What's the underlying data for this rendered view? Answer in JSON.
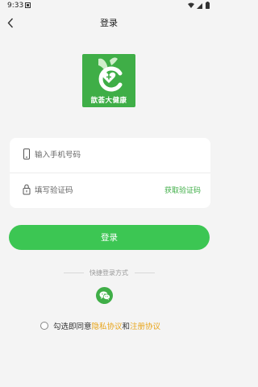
{
  "status_bar": {
    "time": "9:33"
  },
  "header": {
    "title": "登录"
  },
  "logo": {
    "text": "歆荟大健康"
  },
  "form": {
    "phone_placeholder": "输入手机号码",
    "code_placeholder": "填写验证码",
    "get_code_label": "获取验证码"
  },
  "login_button": {
    "label": "登录"
  },
  "quick_login": {
    "label": "快捷登录方式"
  },
  "agreement": {
    "prefix": "勾选即同意",
    "privacy_link": "隐私协议",
    "and": "和",
    "register_link": "注册协议"
  },
  "colors": {
    "accent": "#3cc653",
    "brand_green": "#3fae47",
    "link": "#e8a51b",
    "background": "#f4f4f4"
  },
  "icons": [
    "notification-icon",
    "wifi-icon",
    "signal-icon",
    "battery-icon",
    "back-arrow-icon",
    "phone-icon",
    "lock-icon",
    "wechat-icon"
  ]
}
